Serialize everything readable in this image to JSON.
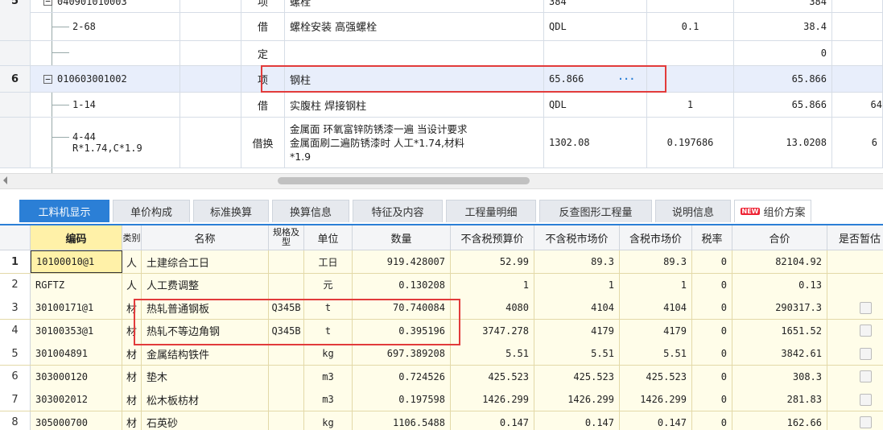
{
  "upper": {
    "rows": [
      {
        "num": "5",
        "code": "040901010003",
        "type": "项",
        "name": "螺栓",
        "unit": "",
        "qty": "384",
        "val": "384",
        "extra": ""
      },
      {
        "num": "",
        "code": "2-68",
        "type": "借",
        "name": "螺栓安装 高强螺栓",
        "unit": "QDL",
        "qty": "0.1",
        "val": "38.4",
        "extra": ""
      },
      {
        "num": "",
        "code": "",
        "type": "定",
        "name": "",
        "unit": "",
        "qty": "",
        "val": "0",
        "extra": ""
      },
      {
        "num": "6",
        "code": "010603001002",
        "type": "项",
        "name": "钢柱",
        "unit": "65.866",
        "qty": "",
        "val": "65.866",
        "extra": ""
      },
      {
        "num": "",
        "code": "1-14",
        "type": "借",
        "name": "实腹柱 焊接钢柱",
        "unit": "QDL",
        "qty": "1",
        "val": "65.866",
        "extra": "64"
      },
      {
        "num": "",
        "code": "4-44",
        "code2": "R*1.74,C*1.9",
        "type": "借换",
        "name": "金属面 环氧富锌防锈漆一遍  当设计要求",
        "name2": "金属面刷二遍防锈漆时 人工*1.74,材料",
        "name3": "*1.9",
        "unit": "1302.08",
        "qty": "0.197686",
        "val": "13.0208",
        "extra": "6"
      }
    ],
    "ellipsis": "···"
  },
  "tabs": [
    {
      "label": "工料机显示",
      "active": true
    },
    {
      "label": "单价构成"
    },
    {
      "label": "标准换算"
    },
    {
      "label": "换算信息"
    },
    {
      "label": "特征及内容"
    },
    {
      "label": "工程量明细"
    },
    {
      "label": "反查图形工程量"
    },
    {
      "label": "说明信息"
    },
    {
      "label": "组价方案",
      "badge": "NEW"
    }
  ],
  "lower": {
    "headers": {
      "code": "编码",
      "type": "类别",
      "name": "名称",
      "spec": "规格及型",
      "unit": "单位",
      "qty": "数量",
      "budget": "不含税预算价",
      "market": "不含税市场价",
      "taxmarket": "含税市场价",
      "rate": "税率",
      "total": "合价",
      "temp": "是否暂估"
    },
    "rows": [
      {
        "n": "1",
        "code": "10100010@1",
        "type": "人",
        "name": "土建综合工日",
        "spec": "",
        "unit": "工日",
        "qty": "919.428007",
        "budget": "52.99",
        "market": "89.3",
        "taxmarket": "89.3",
        "rate": "0",
        "total": "82104.92",
        "check": false
      },
      {
        "n": "2",
        "code": "RGFTZ",
        "type": "人",
        "name": "人工费调整",
        "spec": "",
        "unit": "元",
        "qty": "0.130208",
        "budget": "1",
        "market": "1",
        "taxmarket": "1",
        "rate": "0",
        "total": "0.13",
        "check": false
      },
      {
        "n": "3",
        "code": "30100171@1",
        "type": "材",
        "name": "热轧普通钢板",
        "spec": "Q345B",
        "unit": "t",
        "qty": "70.740084",
        "budget": "4080",
        "market": "4104",
        "taxmarket": "4104",
        "rate": "0",
        "total": "290317.3",
        "check": true
      },
      {
        "n": "4",
        "code": "30100353@1",
        "type": "材",
        "name": "热轧不等边角钢",
        "spec": "Q345B",
        "unit": "t",
        "qty": "0.395196",
        "budget": "3747.278",
        "market": "4179",
        "taxmarket": "4179",
        "rate": "0",
        "total": "1651.52",
        "check": true
      },
      {
        "n": "5",
        "code": "301004891",
        "type": "材",
        "name": "金属结构铁件",
        "spec": "",
        "unit": "kg",
        "qty": "697.389208",
        "budget": "5.51",
        "market": "5.51",
        "taxmarket": "5.51",
        "rate": "0",
        "total": "3842.61",
        "check": true
      },
      {
        "n": "6",
        "code": "303000120",
        "type": "材",
        "name": "垫木",
        "spec": "",
        "unit": "m3",
        "qty": "0.724526",
        "budget": "425.523",
        "market": "425.523",
        "taxmarket": "425.523",
        "rate": "0",
        "total": "308.3",
        "check": true
      },
      {
        "n": "7",
        "code": "303002012",
        "type": "材",
        "name": "松木板枋材",
        "spec": "",
        "unit": "m3",
        "qty": "0.197598",
        "budget": "1426.299",
        "market": "1426.299",
        "taxmarket": "1426.299",
        "rate": "0",
        "total": "281.83",
        "check": true
      },
      {
        "n": "8",
        "code": "305000700",
        "type": "材",
        "name": "石英砂",
        "spec": "",
        "unit": "kg",
        "qty": "1106.5488",
        "budget": "0.147",
        "market": "0.147",
        "taxmarket": "0.147",
        "rate": "0",
        "total": "162.66",
        "check": true
      }
    ]
  }
}
